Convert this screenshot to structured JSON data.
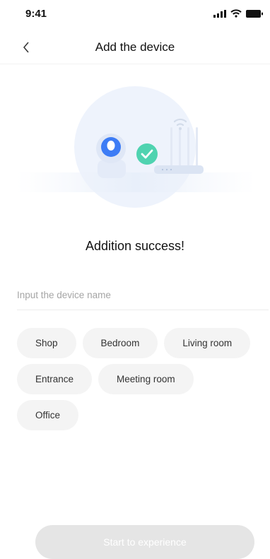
{
  "status_bar": {
    "time": "9:41"
  },
  "nav": {
    "title": "Add the device"
  },
  "main": {
    "success_text": "Addition success!",
    "name_input": {
      "placeholder": "Input the device name",
      "value": ""
    },
    "tags": [
      [
        "Shop",
        "Bedroom",
        "Living room"
      ],
      [
        "Entrance",
        "Meeting room"
      ],
      [
        "Office"
      ]
    ]
  },
  "footer": {
    "start_label": "Start to experience"
  },
  "colors": {
    "accent": "#4fd3b0",
    "camera": "#3d7cf5",
    "button_disabled": "#e5e5e5"
  }
}
